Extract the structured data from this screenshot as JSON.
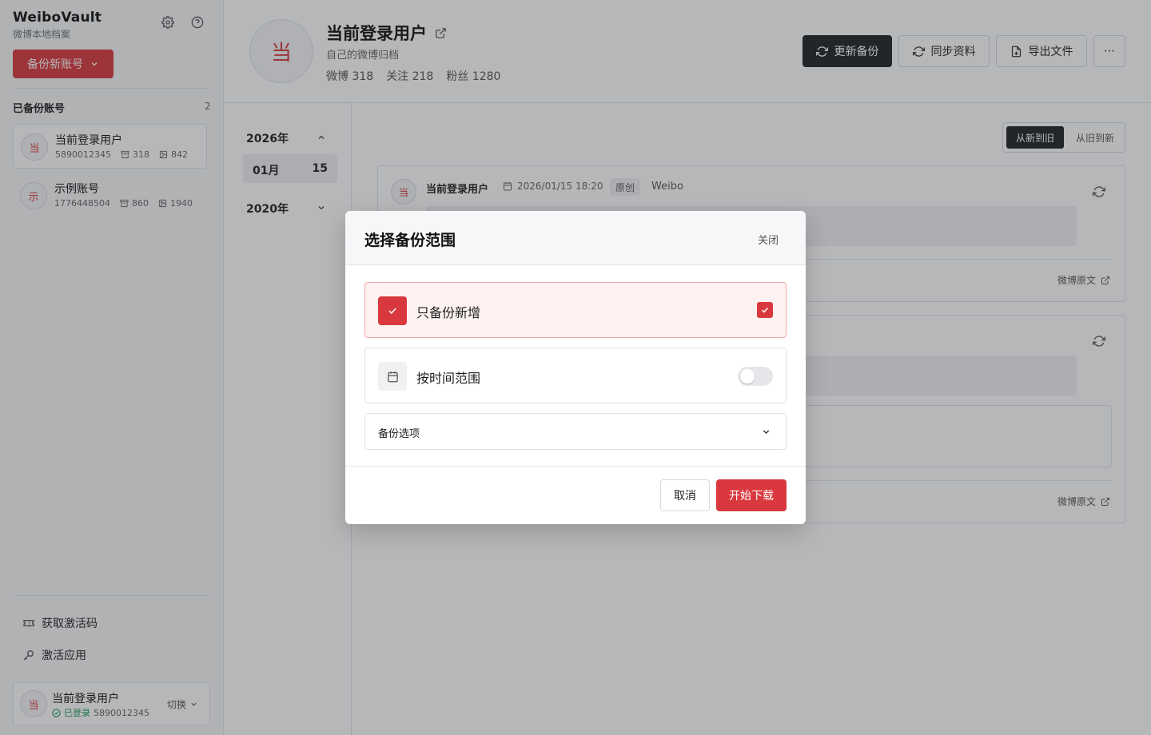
{
  "brand": {
    "title": "WeiboVault",
    "subtitle": "微博本地档案"
  },
  "sidebar": {
    "new_backup_label": "备份新账号",
    "section_title": "已备份账号",
    "section_count": "2",
    "accounts": [
      {
        "avatar": "当",
        "name": "当前登录用户",
        "uid": "5890012345",
        "posts": "318",
        "images": "842",
        "selected": true
      },
      {
        "avatar": "示",
        "name": "示例账号",
        "uid": "1776448504",
        "posts": "860",
        "images": "1940",
        "selected": false
      }
    ],
    "footer_items": [
      {
        "label": "获取激活码",
        "icon": "ticket-icon"
      },
      {
        "label": "激活应用",
        "icon": "key-icon"
      }
    ],
    "user": {
      "avatar": "当",
      "name": "当前登录用户",
      "status": "已登录",
      "uid": "5890012345",
      "switch_label": "切换"
    }
  },
  "header": {
    "avatar": "当",
    "name": "当前登录用户",
    "description": "自己的微博归档",
    "stats": [
      "微博 318",
      "关注 218",
      "粉丝 1280"
    ],
    "buttons": {
      "update": "更新备份",
      "sync": "同步资料",
      "export": "导出文件",
      "more": "⋯"
    }
  },
  "timeline": {
    "years": [
      {
        "label": "2026年",
        "expanded": true
      },
      {
        "label": "2020年",
        "expanded": false
      }
    ],
    "month": {
      "label": "01月",
      "count": "15"
    }
  },
  "sort": {
    "newest": "从新到旧",
    "oldest": "从旧到新",
    "active": "newest"
  },
  "posts": [
    {
      "avatar": "当",
      "author": "当前登录用户",
      "time": "2026/01/15 18:20",
      "tag": "原创",
      "source": "Weibo",
      "link": "微博原文"
    },
    {
      "link": "微博原文"
    }
  ],
  "modal": {
    "title": "选择备份范围",
    "close": "关闭",
    "option_new": {
      "label": "只备份新增",
      "checked": true
    },
    "option_range": {
      "label": "按时间范围",
      "enabled": false
    },
    "accordion": "备份选项",
    "cancel": "取消",
    "start": "开始下载"
  },
  "colors": {
    "accent": "#d9393e",
    "dark": "#1f2328",
    "success": "#1a9b5a"
  }
}
